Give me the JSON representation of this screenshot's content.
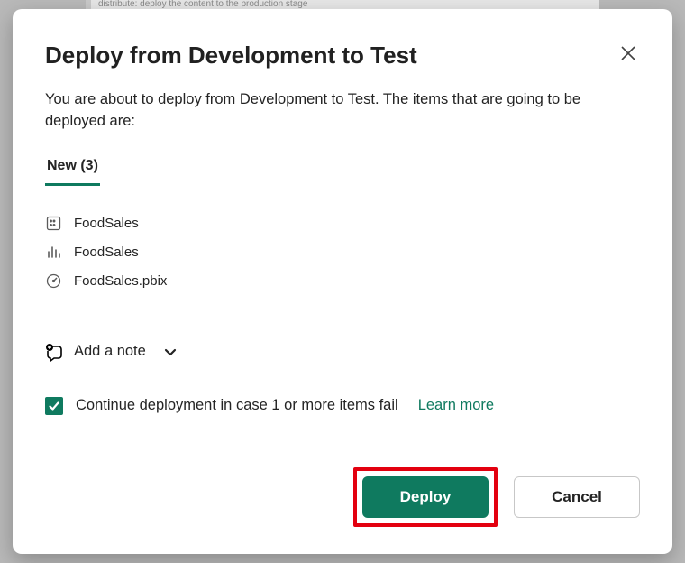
{
  "backdrop_hint": "distribute: deploy the content to the production stage",
  "dialog": {
    "title": "Deploy from Development to Test",
    "description": "You are about to deploy from Development to Test. The items that are going to be deployed are:",
    "tab_label": "New (3)",
    "items": [
      {
        "icon": "dataset-icon",
        "name": "FoodSales"
      },
      {
        "icon": "report-icon",
        "name": "FoodSales"
      },
      {
        "icon": "gauge-icon",
        "name": "FoodSales.pbix"
      }
    ],
    "add_note_label": "Add a note",
    "continue_label": "Continue deployment in case 1 or more items fail",
    "learn_more_label": "Learn more",
    "deploy_label": "Deploy",
    "cancel_label": "Cancel"
  },
  "colors": {
    "accent": "#0f7a5f",
    "highlight": "#e3000f"
  }
}
